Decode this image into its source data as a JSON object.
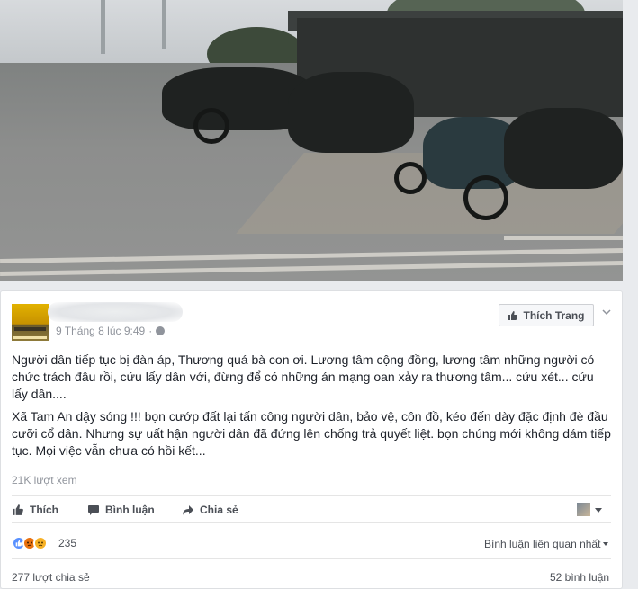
{
  "post": {
    "timestamp": "9 Tháng 8 lúc 9:49",
    "separator": "·",
    "like_page_label": "Thích Trang",
    "paragraph_1": "Người dân tiếp tục bị đàn áp, Thương quá bà con ơi. Lương tâm cộng đồng, lương tâm những người có chức trách đâu rồi, cứu lấy dân với, đừng để có những án mạng oan xảy ra thương tâm... cứu xét... cứu lấy dân....",
    "paragraph_2": "Xã Tam An dậy sóng !!! bọn cướp đất lại tấn công người dân, bảo vệ, côn đồ, kéo đến dày đặc định đè đầu cưỡi cổ dân. Nhưng sự uất hận người dân đã đứng lên chống trả quyết liệt. bọn chúng mới không dám tiếp tục. Mọi việc vẫn chưa có hồi kết...",
    "views": "21K lượt xem"
  },
  "actions": {
    "like": "Thích",
    "comment": "Bình luận",
    "share": "Chia sẻ"
  },
  "stats": {
    "reactions_count": "235",
    "sort_label": "Bình luận liên quan nhất",
    "shares": "277 lượt chia sẻ",
    "comments": "52 bình luận"
  },
  "icons": {
    "like": "thumbs-up-icon",
    "comment": "speech-bubble-icon",
    "share": "share-arrow-icon",
    "privacy": "globe-icon",
    "menu": "chevron-down-icon"
  },
  "colors": {
    "background": "#e9ebee",
    "card": "#ffffff",
    "muted_text": "#90949c",
    "action_text": "#4b4f56",
    "like_react": "#5890ff",
    "angry_react": "#e9710f",
    "sad_react": "#f7b125"
  }
}
